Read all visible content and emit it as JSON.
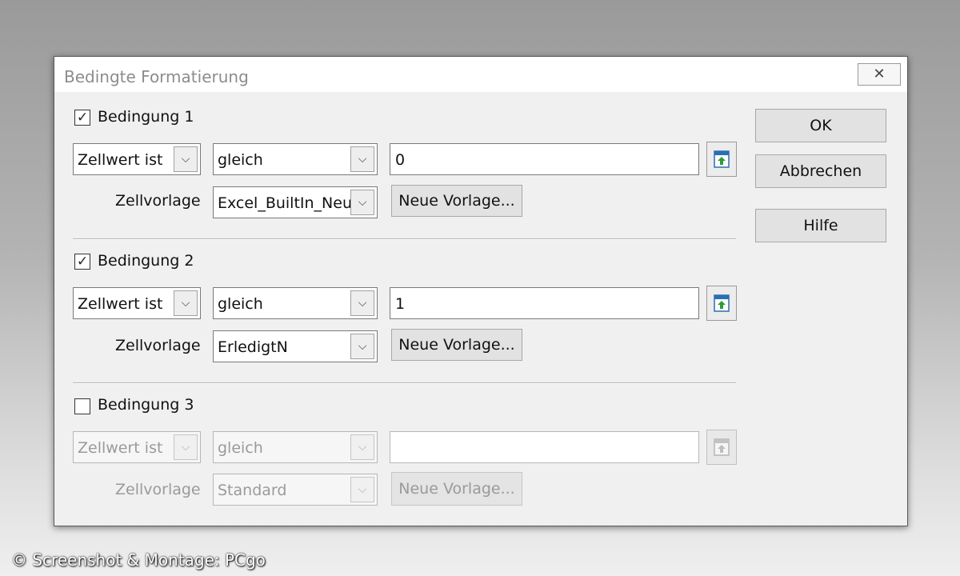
{
  "dialog": {
    "title": "Bedingte Formatierung",
    "close_label": "✕"
  },
  "conditions": [
    {
      "checked": true,
      "label": "Bedingung 1",
      "type_value": "Zellwert ist",
      "operator_value": "gleich",
      "value": "0",
      "style_label": "Zellvorlage",
      "style_value": "Excel_BuiltIn_Neut",
      "new_style_label": "Neue Vorlage...",
      "enabled": true
    },
    {
      "checked": true,
      "label": "Bedingung 2",
      "type_value": "Zellwert ist",
      "operator_value": "gleich",
      "value": "1",
      "style_label": "Zellvorlage",
      "style_value": "ErledigtN",
      "new_style_label": "Neue Vorlage...",
      "enabled": true
    },
    {
      "checked": false,
      "label": "Bedingung 3",
      "type_value": "Zellwert ist",
      "operator_value": "gleich",
      "value": "",
      "style_label": "Zellvorlage",
      "style_value": "Standard",
      "new_style_label": "Neue Vorlage...",
      "enabled": false
    }
  ],
  "buttons": {
    "ok": "OK",
    "cancel": "Abbrechen",
    "help": "Hilfe"
  },
  "icons": {
    "shrink": "shrink-icon",
    "dropdown": "chevron-down-icon",
    "check": "checkmark-icon"
  },
  "copyright": "© Screenshot & Montage: PCgo"
}
